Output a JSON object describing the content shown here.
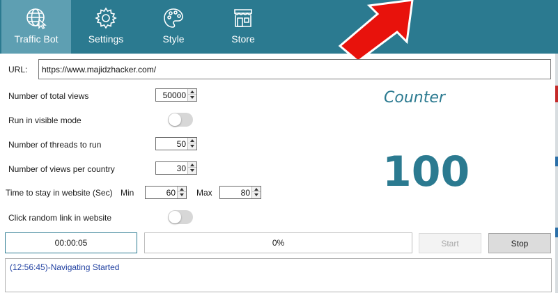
{
  "tabs": [
    {
      "label": "Traffic Bot",
      "icon": "globe-cursor-icon",
      "active": true
    },
    {
      "label": "Settings",
      "icon": "gear-icon",
      "active": false
    },
    {
      "label": "Style",
      "icon": "palette-icon",
      "active": false
    },
    {
      "label": "Store",
      "icon": "store-icon",
      "active": false
    }
  ],
  "form": {
    "url_label": "URL:",
    "url_value": "https://www.majidzhacker.com/",
    "total_views_label": "Number of total views",
    "total_views_value": "50000",
    "visible_mode_label": "Run in visible mode",
    "visible_mode_on": false,
    "threads_label": "Number of threads to run",
    "threads_value": "50",
    "views_per_country_label": "Number of views per country",
    "views_per_country_value": "30",
    "time_label": "Time to stay in website (Sec)",
    "min_label": "Min",
    "min_value": "60",
    "max_label": "Max",
    "max_value": "80",
    "random_link_label": "Click random link in website",
    "random_link_on": false
  },
  "counter": {
    "title": "Counter",
    "value": "100"
  },
  "status": {
    "timer": "00:00:05",
    "progress_text": "0%",
    "progress_fraction": 0
  },
  "buttons": {
    "start": "Start",
    "stop": "Stop"
  },
  "log": {
    "lines": [
      "(12:56:45)-Navigating Started"
    ]
  },
  "colors": {
    "header": "#2b7a90",
    "active_tab": "#5e9fb2",
    "counter": "#2b7a90",
    "log_text": "#1f3fa0",
    "annotation_arrow": "#e8120c"
  }
}
